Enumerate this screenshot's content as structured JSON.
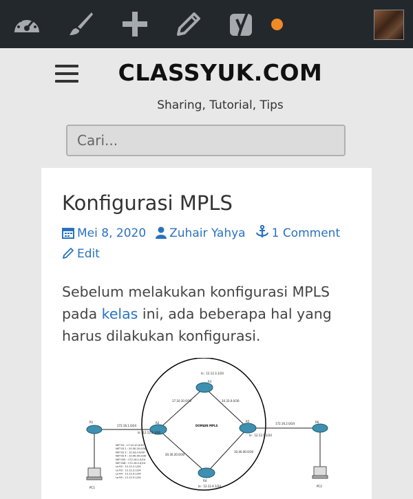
{
  "admin_bar": {
    "items": [
      "dashboard-icon",
      "customize-brush-icon",
      "new-plus-icon",
      "edit-pencil-icon",
      "yoast-seo-icon"
    ],
    "notification_color": "#f08a24"
  },
  "site": {
    "title": "CLASSYUK.COM",
    "tagline": "Sharing, Tutorial, Tips"
  },
  "search": {
    "placeholder": "Cari..."
  },
  "post": {
    "title": "Konfigurasi MPLS",
    "date": "Mei 8, 2020",
    "author": "Zuhair Yahya",
    "comments": "1 Comment",
    "edit": "Edit",
    "text_before": "Sebelum melakukan konfigurasi MPLS pada ",
    "link": "kelas",
    "text_after": " ini, ada beberapa hal yang harus dilakukan konfigurasi."
  },
  "diagram": {
    "domain": "DOMAIN MPLS",
    "r2_label": "R2",
    "r3_label": "R3",
    "r1_label": "R1",
    "r4_label": "R4",
    "r5_label": "R5",
    "r6_label": "R6",
    "pc1": "PC1",
    "pc2": "PC2",
    "lo2": "lo : 12.12.2.1/24",
    "lo3": "lo : 12.12.3.1/24",
    "lo4": "lo : 12.12.4.1/24",
    "lo5": "lo : 12.12.5.1/24",
    "net_r1r2": "172.16.1.0/24",
    "net_r5r6": "172.16.2.0/24",
    "net_23": "17.10.10.0/30",
    "net_35": "10.33.0.0/30",
    "net_24": "20.30.20.0/30",
    "net_45": "10.40.40.0/30",
    "notes": [
      "NET ID : 17.10.10.0/30",
      "NET ID 2 : 20.30.20.0/30",
      "NET ID 3 : 10.33.0.0/30",
      "NET ID 4 : 10.40.40.0/30",
      "NET ID5 : 172.16.1.0/24",
      "NET ID6 : 172.16.2.0/24",
      "Lo R2 : 12.12.2.1/24",
      "Lo R3 : 12.12.3.1/24",
      "Lo R4 : 12.12.4.1/24",
      "Lo R5 : 12.12.5.1/24"
    ]
  }
}
